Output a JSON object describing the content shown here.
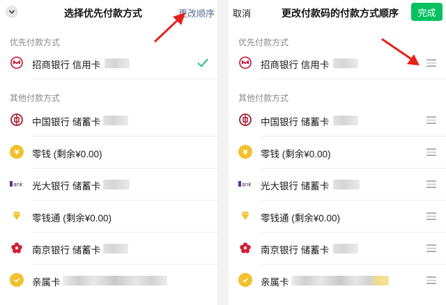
{
  "left": {
    "title": "选择优先付款方式",
    "change_order_label": "更改顺序",
    "preferred_section": "优先付款方式",
    "other_section": "其他付款方式",
    "preferred": {
      "label": "招商银行 信用卡",
      "icon": "cmb-bank-icon"
    },
    "others": [
      {
        "label": "中国银行 储蓄卡",
        "icon": "boc-bank-icon"
      },
      {
        "label": "零钱 (剩余¥0.00)",
        "icon": "change-coin-icon"
      },
      {
        "label": "光大银行 储蓄卡",
        "icon": "ceb-bank-icon"
      },
      {
        "label": "零钱通 (剩余¥0.00)",
        "icon": "lingqiantong-icon"
      },
      {
        "label": "南京银行 储蓄卡",
        "icon": "njcb-bank-icon"
      },
      {
        "label": "亲属卡",
        "icon": "family-card-icon"
      }
    ]
  },
  "right": {
    "cancel_label": "取消",
    "title": "更改付款码的付款方式顺序",
    "done_label": "完成",
    "preferred_section": "优先付款方式",
    "other_section": "其他付款方式",
    "preferred": {
      "label": "招商银行 信用卡",
      "icon": "cmb-bank-icon"
    },
    "others": [
      {
        "label": "中国银行 储蓄卡",
        "icon": "boc-bank-icon"
      },
      {
        "label": "零钱 (剩余¥0.00)",
        "icon": "change-coin-icon"
      },
      {
        "label": "光大银行 储蓄卡",
        "icon": "ceb-bank-icon"
      },
      {
        "label": "零钱通 (剩余¥0.00)",
        "icon": "lingqiantong-icon"
      },
      {
        "label": "南京银行 储蓄卡",
        "icon": "njcb-bank-icon"
      },
      {
        "label": "亲属卡",
        "icon": "family-card-icon"
      }
    ]
  },
  "colors": {
    "accent_green": "#07c160",
    "link_blue": "#576b95",
    "annotation_red": "#e8201a",
    "cmb_red": "#c8102e",
    "boc_red": "#a3182c",
    "coin_gold": "#f2c12e",
    "ceb_purple": "#6a2c91",
    "njcb_red": "#d0203a"
  }
}
